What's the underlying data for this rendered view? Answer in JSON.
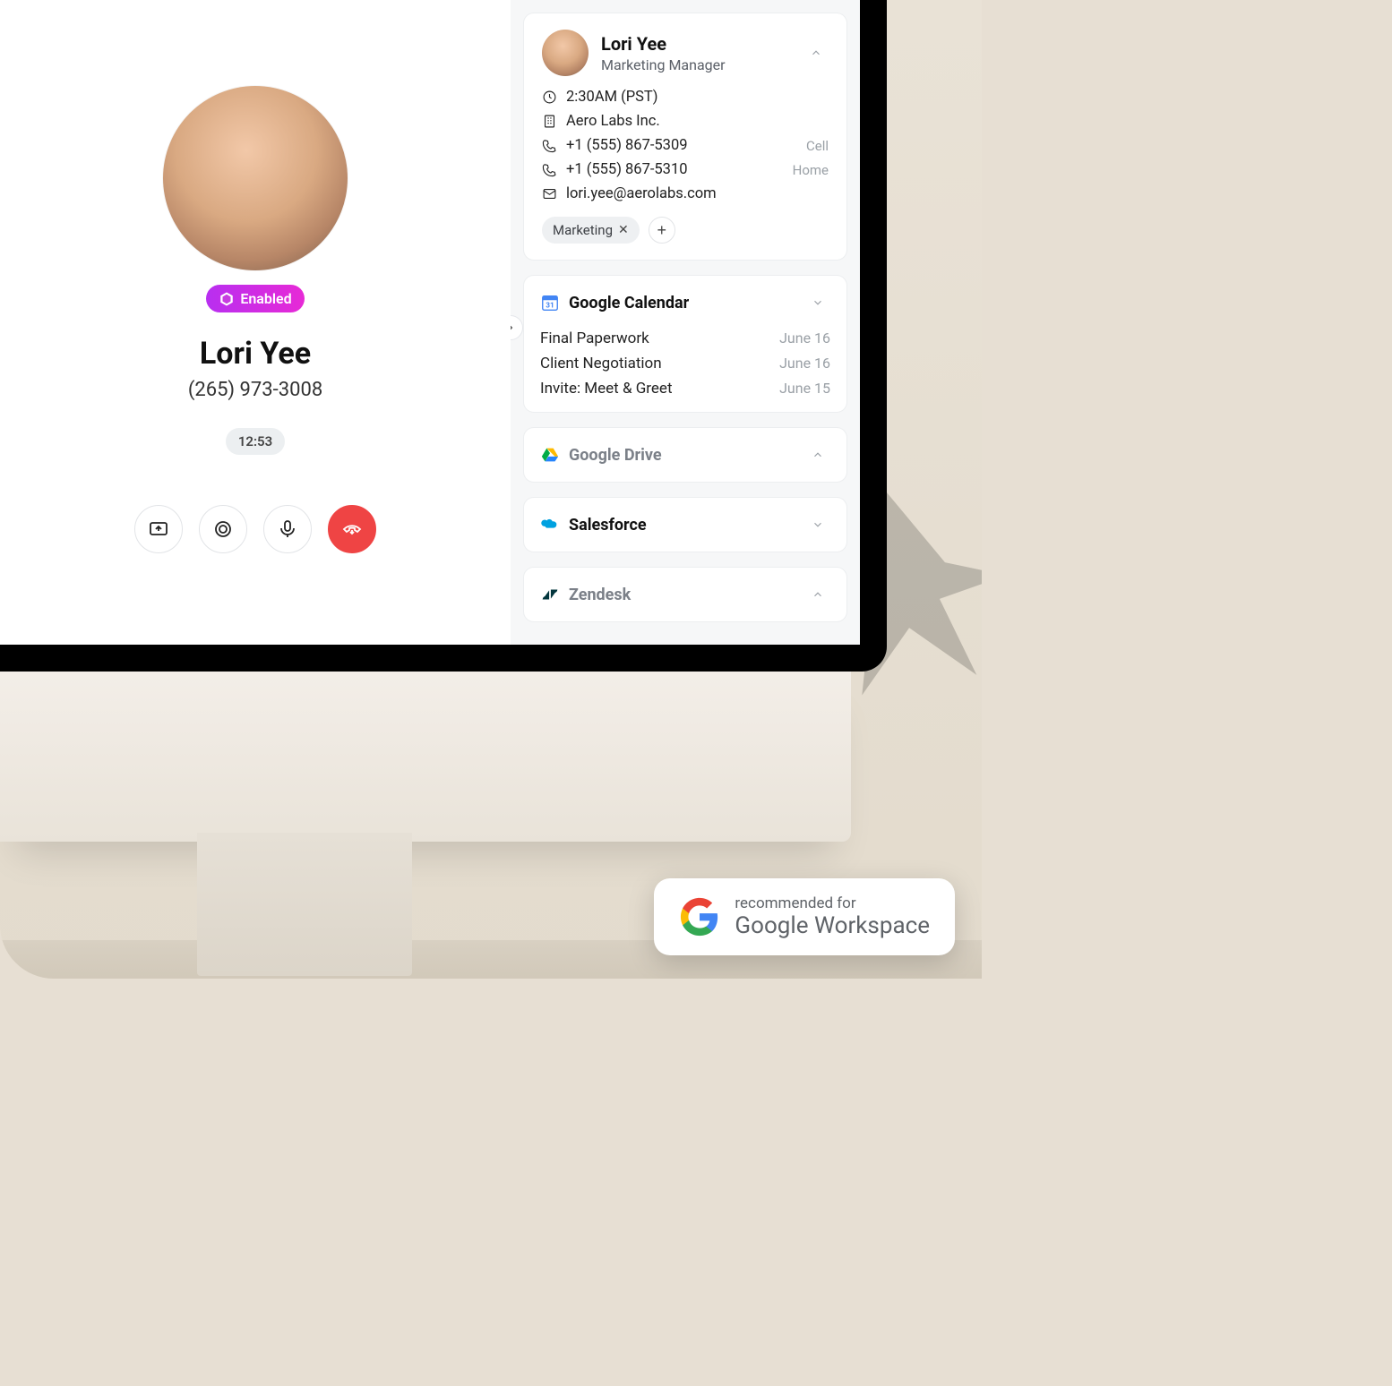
{
  "call": {
    "enabled_label": "Enabled",
    "name": "Lori Yee",
    "phone": "(265) 973-3008",
    "timer": "12:53"
  },
  "contact": {
    "name": "Lori Yee",
    "role": "Marketing Manager",
    "time": "2:30AM (PST)",
    "company": "Aero Labs Inc.",
    "phone1": "+1 (555) 867-5309",
    "phone1_label": "Cell",
    "phone2": "+1 (555) 867-5310",
    "phone2_label": "Home",
    "email": "lori.yee@aerolabs.com",
    "tag": "Marketing"
  },
  "integrations": {
    "calendar": {
      "title": "Google Calendar",
      "events": [
        {
          "title": "Final Paperwork",
          "date": "June 16"
        },
        {
          "title": "Client Negotiation",
          "date": "June 16"
        },
        {
          "title": "Invite: Meet & Greet",
          "date": "June 15"
        }
      ]
    },
    "drive": {
      "title": "Google Drive"
    },
    "salesforce": {
      "title": "Salesforce"
    },
    "zendesk": {
      "title": "Zendesk"
    }
  },
  "workspace_badge": {
    "line1": "recommended for",
    "line2": "Google Workspace"
  }
}
